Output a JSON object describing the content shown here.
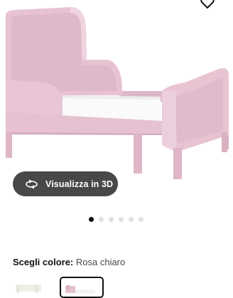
{
  "product": {
    "image_alt": "Struttura letto allungabile rosa chiaro"
  },
  "viewer": {
    "button_label": "Visualizza in 3D",
    "button_icon": "rotate-360-icon"
  },
  "carousel": {
    "total": 6,
    "active_index": 0
  },
  "color_picker": {
    "label": "Scegli colore:",
    "selected_value": "Rosa chiaro",
    "swatches": [
      {
        "name": "Bianco",
        "color": "#f2f1ea"
      },
      {
        "name": "Rosa chiaro",
        "color": "#e8c7d6"
      }
    ]
  },
  "header": {
    "favorite_icon": "heart-icon"
  },
  "colors": {
    "accent": "#484848",
    "bed": "#e8c7d6",
    "mattress": "#fafafa"
  }
}
